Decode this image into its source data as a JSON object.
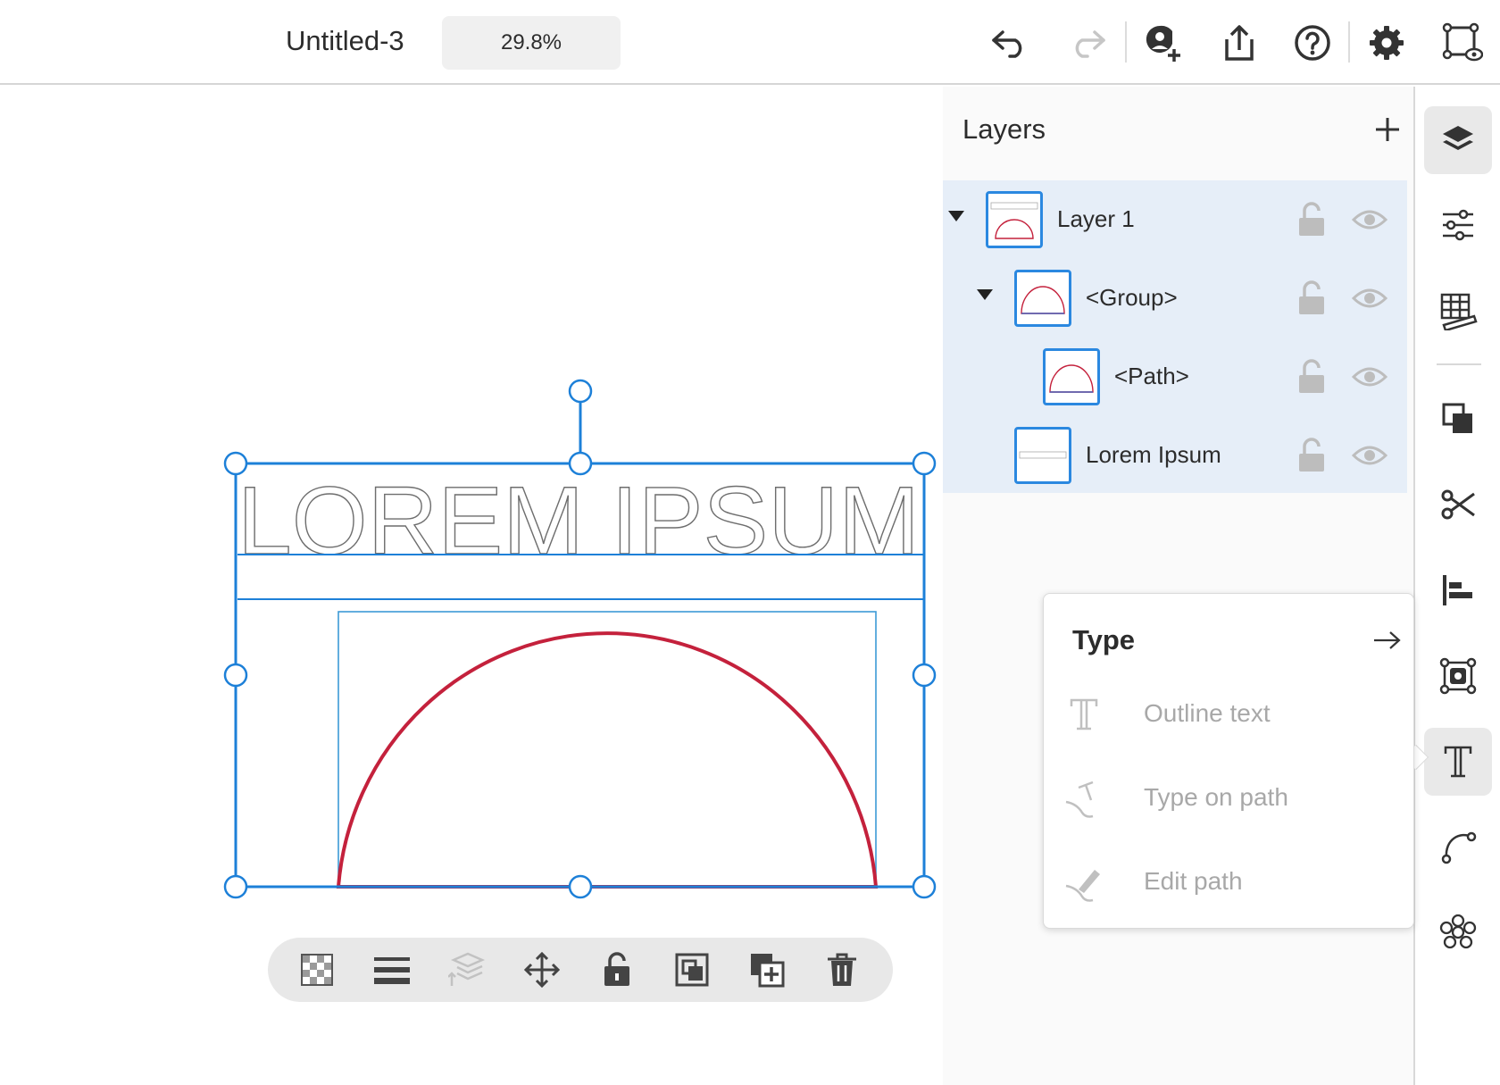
{
  "document": {
    "title": "Untitled-3",
    "zoom": "29.8%"
  },
  "topbar": {
    "buttons": [
      "undo-icon",
      "redo-icon",
      "invite-icon",
      "share-icon",
      "help-icon",
      "settings-icon",
      "preview-icon"
    ]
  },
  "canvas": {
    "text_content": "LOREM IPSUM"
  },
  "bottom_toolbar": {
    "buttons": [
      "transparency-icon",
      "stroke-icon",
      "arrange-icon",
      "move-icon",
      "lock-icon",
      "mask-icon",
      "duplicate-icon",
      "delete-icon"
    ]
  },
  "layers": {
    "title": "Layers",
    "items": [
      {
        "label": "Layer 1",
        "expanded": true
      },
      {
        "label": "<Group>",
        "expanded": true
      },
      {
        "label": "<Path>"
      },
      {
        "label": "Lorem Ipsum"
      }
    ]
  },
  "right_rail": {
    "buttons": [
      "layers-icon",
      "properties-icon",
      "grid-ruler-icon",
      "combine-shapes-icon",
      "cut-icon",
      "align-icon",
      "image-trace-icon",
      "type-icon",
      "path-icon",
      "repeat-icon"
    ],
    "active": "type-icon"
  },
  "type_popover": {
    "title": "Type",
    "items": [
      {
        "label": "Outline text"
      },
      {
        "label": "Type on path"
      },
      {
        "label": "Edit path"
      }
    ]
  },
  "colors": {
    "accent": "#2b88e0",
    "path_stroke": "#c4213c",
    "selection": "#1d80d8"
  }
}
